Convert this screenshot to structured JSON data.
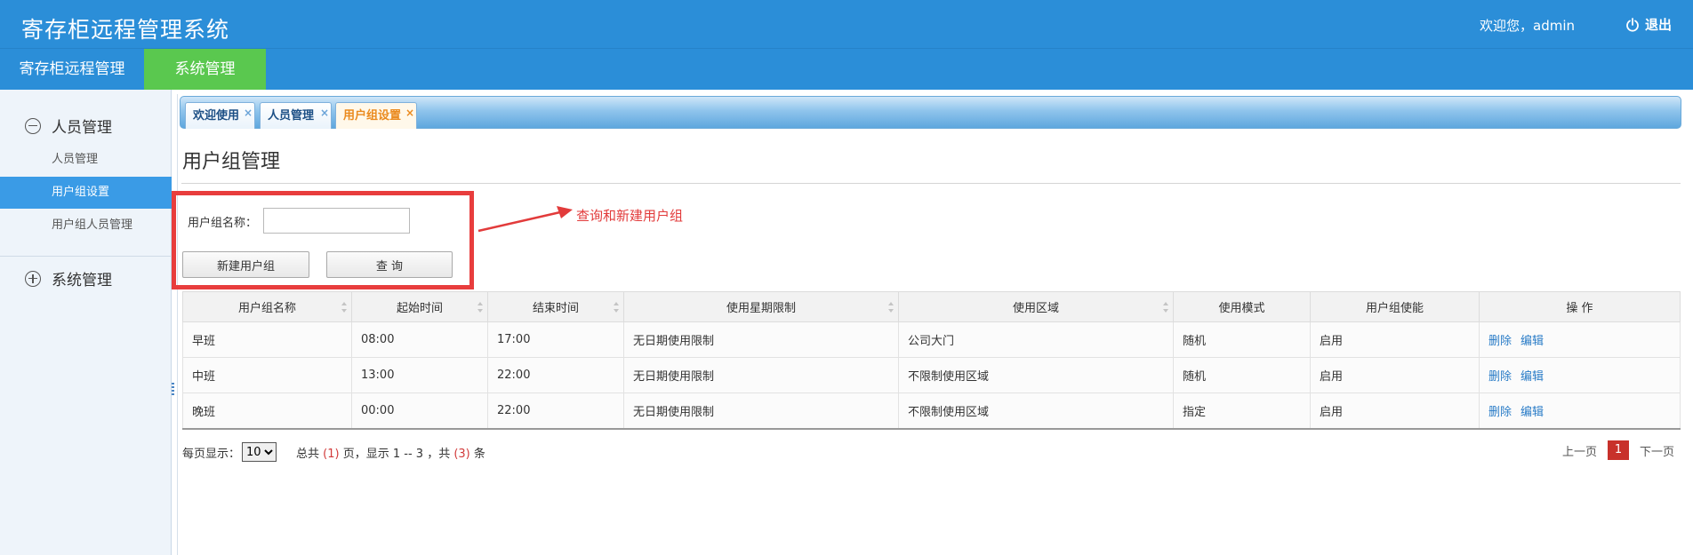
{
  "header": {
    "app_title": "寄存柜远程管理系统",
    "welcome": "欢迎您，admin",
    "logout_label": "退出"
  },
  "nav": {
    "items": [
      {
        "label": "寄存柜远程管理"
      },
      {
        "label": "系统管理",
        "active": true
      }
    ],
    "active_color": "#5ac84f",
    "bar_color": "#2b8ed8"
  },
  "sidebar": {
    "groups": [
      {
        "label": "人员管理",
        "icon": "minus-circle-icon",
        "items": [
          {
            "label": "人员管理"
          },
          {
            "label": "用户组设置",
            "active": true
          },
          {
            "label": "用户组人员管理"
          }
        ]
      },
      {
        "label": "系统管理",
        "icon": "plus-circle-icon",
        "items": []
      }
    ]
  },
  "tabs": [
    {
      "label": "欢迎使用"
    },
    {
      "label": "人员管理"
    },
    {
      "label": "用户组设置",
      "active": true
    }
  ],
  "tab_close_glyph": "×",
  "page": {
    "title": "用户组管理",
    "search_label": "用户组名称：",
    "search_value": "",
    "new_button": "新建用户组",
    "query_button": "查 询",
    "annotation": "查询和新建用户组"
  },
  "table": {
    "columns": [
      "用户组名称",
      "起始时间",
      "结束时间",
      "使用星期限制",
      "使用区域",
      "使用模式",
      "用户组使能",
      "操 作"
    ],
    "rows": [
      {
        "name": "早班",
        "start": "08:00",
        "end": "17:00",
        "week": "无日期使用限制",
        "area": "公司大门",
        "mode": "随机",
        "enabled": "启用"
      },
      {
        "name": "中班",
        "start": "13:00",
        "end": "22:00",
        "week": "无日期使用限制",
        "area": "不限制使用区域",
        "mode": "随机",
        "enabled": "启用"
      },
      {
        "name": "晚班",
        "start": "00:00",
        "end": "22:00",
        "week": "无日期使用限制",
        "area": "不限制使用区域",
        "mode": "指定",
        "enabled": "启用"
      }
    ],
    "action_delete": "删除",
    "action_edit": "编辑"
  },
  "pager": {
    "per_page_label": "每页显示：",
    "per_page_value": "10",
    "sum_prefix": "总共",
    "pages": "(1)",
    "sum_mid": "页，显示 1 -- 3 ，共",
    "total": "(3)",
    "sum_suffix": "条",
    "prev": "上一页",
    "current": "1",
    "next": "下一页"
  }
}
